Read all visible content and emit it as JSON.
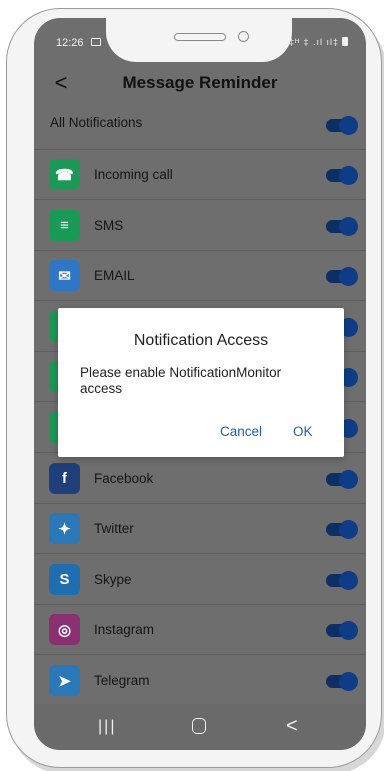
{
  "status_bar": {
    "time": "12:26",
    "right_indicators": "‡ᴴ ‡ .ıl ıl‡"
  },
  "header": {
    "back_glyph": "<",
    "title": "Message Reminder"
  },
  "all_notifications": {
    "label": "All Notifications",
    "enabled": true
  },
  "apps": [
    {
      "label": "Incoming call",
      "icon": "phone-icon",
      "color": "#1a9a55",
      "enabled": true
    },
    {
      "label": "SMS",
      "icon": "sms-icon",
      "color": "#1a9a55",
      "enabled": true
    },
    {
      "label": "EMAIL",
      "icon": "mail-icon",
      "color": "#2f76c4",
      "enabled": true
    },
    {
      "label": "",
      "icon": "whatsapp-icon",
      "color": "#1a9a55",
      "enabled": true
    },
    {
      "label": "",
      "icon": "messenger-icon",
      "color": "#1a9a55",
      "enabled": true
    },
    {
      "label": "",
      "icon": "wechat-icon",
      "color": "#1a9a55",
      "enabled": true
    },
    {
      "label": "Facebook",
      "icon": "facebook-icon",
      "color": "#1e3f7a",
      "enabled": true
    },
    {
      "label": "Twitter",
      "icon": "twitter-icon",
      "color": "#2a78b8",
      "enabled": true
    },
    {
      "label": "Skype",
      "icon": "skype-icon",
      "color": "#1f6fb0",
      "enabled": true
    },
    {
      "label": "Instagram",
      "icon": "instagram-icon",
      "color": "#8a2f6f",
      "enabled": true
    },
    {
      "label": "Telegram",
      "icon": "telegram-icon",
      "color": "#2a78b8",
      "enabled": true
    }
  ],
  "dialog": {
    "title": "Notification Access",
    "message": "Please enable NotificationMonitor access",
    "cancel_label": "Cancel",
    "ok_label": "OK"
  },
  "nav": {
    "recents_glyph": "|||",
    "back_glyph": "<"
  },
  "colors": {
    "overlay_bg": "#6e6e6e",
    "toggle_on": "#0f3c86",
    "dialog_button": "#1f5fae"
  }
}
